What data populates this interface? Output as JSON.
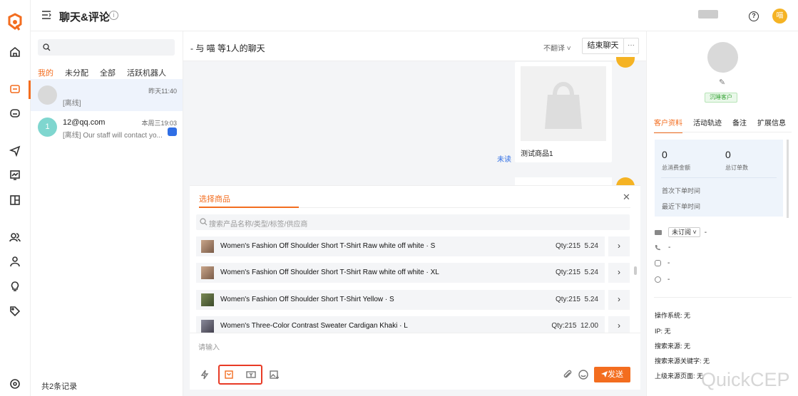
{
  "header": {
    "title": "聊天&评论",
    "user_avatar": "喵"
  },
  "sidebar_icons": [
    "home-icon",
    "chat-icon",
    "robot-icon",
    "send-icon",
    "monitor-icon",
    "layout-icon",
    "users-icon",
    "user-icon",
    "bulb-icon",
    "tag-icon",
    "settings-icon"
  ],
  "conversation_list": {
    "filters": [
      "我的",
      "未分配",
      "全部",
      "活跃机器人"
    ],
    "conversations": [
      {
        "name": "",
        "time": "昨天11:40",
        "preview": "[离线]",
        "avatar": ""
      },
      {
        "name": "12@qq.com",
        "time": "本周三19:03",
        "preview": "[离线] Our staff will contact yo...",
        "avatar": "1"
      }
    ],
    "footer": "共2条记录"
  },
  "chat": {
    "title": "- 与 喵 等1人的聊天",
    "translate": "不翻译 ˅",
    "end_button": "结束聊天",
    "more_button": "···",
    "message_card_caption": "测试商品1",
    "unread_label": "未读"
  },
  "product_panel": {
    "title": "选择商品",
    "search_placeholder": "搜索产品名称/类型/标签/供应商",
    "products": [
      {
        "name": "Women's Fashion Off Shoulder Short T-Shirt Raw white off white · S",
        "qty": "Qty:215",
        "price": "5.24"
      },
      {
        "name": "Women's Fashion Off Shoulder Short T-Shirt Raw white off white · XL",
        "qty": "Qty:215",
        "price": "5.24"
      },
      {
        "name": "Women's Fashion Off Shoulder Short T-Shirt Yellow · S",
        "qty": "Qty:215",
        "price": "5.24"
      },
      {
        "name": "Women's Three-Color Contrast Sweater Cardigan Khaki · L",
        "qty": "Qty:215",
        "price": "12.00"
      }
    ]
  },
  "composer": {
    "placeholder": "请输入",
    "send_label": "发送"
  },
  "customer_info": {
    "tag": "沉睡客户",
    "tabs": [
      "客户资料",
      "活动轨迹",
      "备注",
      "扩展信息"
    ],
    "total_spent": "0",
    "total_spent_label": "总消费金额",
    "total_orders": "0",
    "total_orders_label": "总订单数",
    "first_order_label": "首次下单时间",
    "last_order_label": "最近下单时间",
    "subscription": "未订阅 ˅",
    "email_value": "-",
    "phone_value": "-",
    "instagram_value": "-",
    "messenger_value": "-",
    "os": "操作系统: 无",
    "ip": "IP: 无",
    "search_source": "搜索来源: 无",
    "search_keyword": "搜索来源关键字: 无",
    "referrer": "上级来源页面: 无"
  },
  "watermark": "QuickCEP",
  "colors": {
    "accent": "#f36d1f",
    "link": "#2f6ee5",
    "highlight": "#e83b26"
  }
}
